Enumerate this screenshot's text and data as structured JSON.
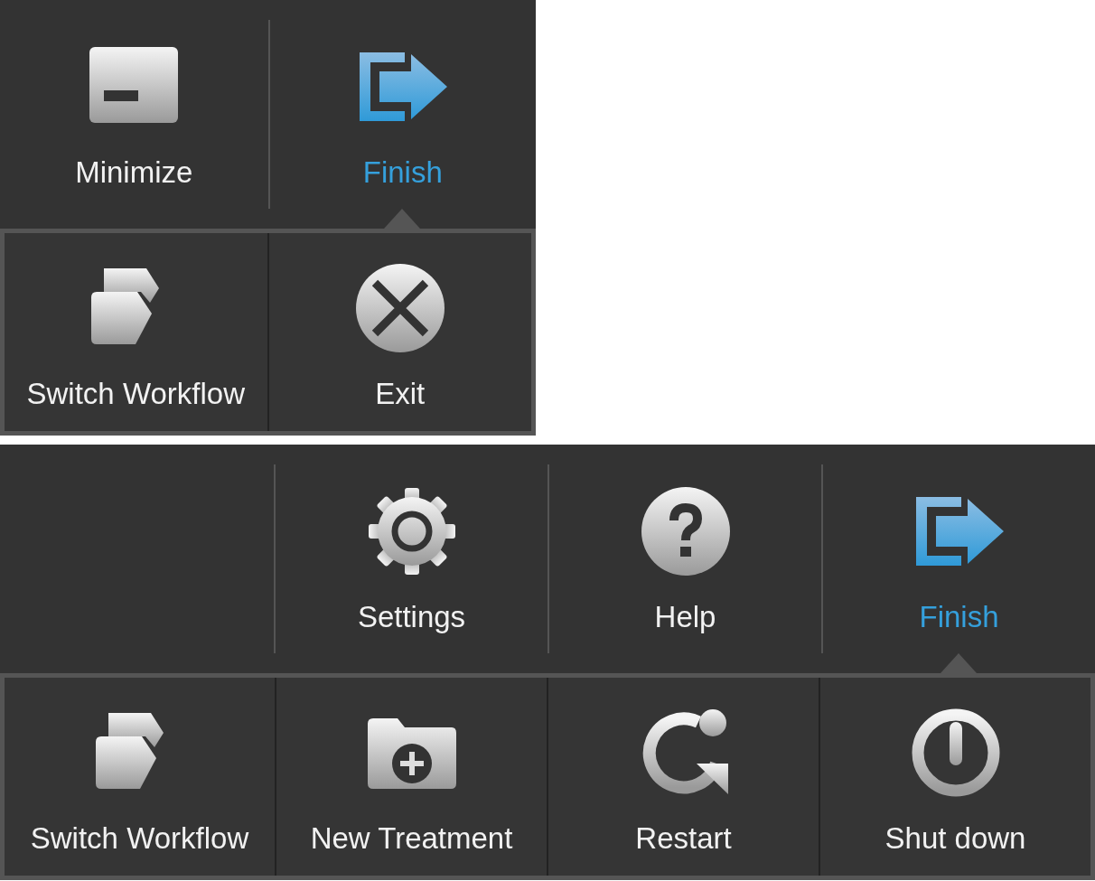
{
  "panels": [
    {
      "toolbar": [
        {
          "label": "Minimize",
          "kind": "minimize",
          "selected": false
        },
        {
          "label": "Finish",
          "kind": "finish",
          "selected": true
        }
      ],
      "submenu": [
        {
          "label": "Switch Workflow",
          "kind": "switch"
        },
        {
          "label": "Exit",
          "kind": "exit"
        }
      ]
    },
    {
      "toolbar": [
        {
          "label": "Settings",
          "kind": "settings",
          "selected": false
        },
        {
          "label": "Help",
          "kind": "help",
          "selected": false
        },
        {
          "label": "Finish",
          "kind": "finish",
          "selected": true
        }
      ],
      "submenu": [
        {
          "label": "Switch Workflow",
          "kind": "switch"
        },
        {
          "label": "New Treatment",
          "kind": "new"
        },
        {
          "label": "Restart",
          "kind": "restart"
        },
        {
          "label": "Shut down",
          "kind": "shutdown"
        }
      ]
    }
  ]
}
